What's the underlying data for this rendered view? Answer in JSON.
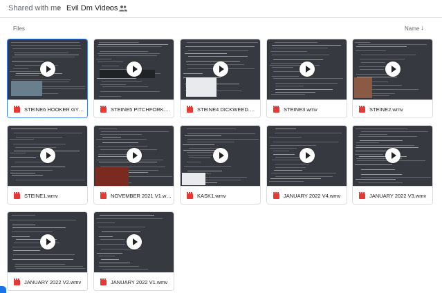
{
  "breadcrumb": {
    "root": "Shared with me",
    "separator": "›",
    "current": "Evil Dm Videos",
    "caret": "▾",
    "shared_icon": "people-icon"
  },
  "list_header": {
    "section_label": "Files",
    "sort_label": "Name",
    "sort_arrow": "↓"
  },
  "files": [
    {
      "name": "STEINE6 HOOKER GYGAX...",
      "icon": "video-file-icon",
      "selected": true
    },
    {
      "name": "STEINE5 PITCHFORK.wmv",
      "icon": "video-file-icon"
    },
    {
      "name": "STEINE4 DICKWEED.wmv",
      "icon": "video-file-icon"
    },
    {
      "name": "STEINE3.wmv",
      "icon": "video-file-icon"
    },
    {
      "name": "STEINE2.wmv",
      "icon": "video-file-icon"
    },
    {
      "name": "STEINE1.wmv",
      "icon": "video-file-icon"
    },
    {
      "name": "NOVEMBER 2021 V1.wmv",
      "icon": "video-file-icon"
    },
    {
      "name": "KASK1.wmv",
      "icon": "video-file-icon"
    },
    {
      "name": "JANUARY 2022 V4.wmv",
      "icon": "video-file-icon"
    },
    {
      "name": "JANUARY 2022 V3.wmv",
      "icon": "video-file-icon"
    },
    {
      "name": "JANUARY 2022 V2.wmv",
      "icon": "video-file-icon"
    },
    {
      "name": "JANUARY 2022 V1.wmv",
      "icon": "video-file-icon"
    }
  ],
  "colors": {
    "accent": "#1a73e8",
    "video_icon": "#e53935",
    "thumb_bg": "#36393f"
  }
}
